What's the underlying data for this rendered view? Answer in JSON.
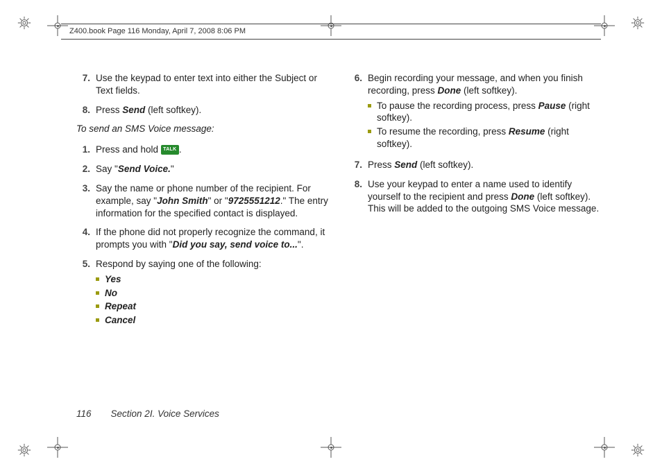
{
  "header": {
    "label": "Z400.book  Page 116  Monday, April 7, 2008  8:06 PM"
  },
  "talk_key_label": "TALK",
  "col1": {
    "cont_steps": [
      {
        "n": "7.",
        "parts": [
          {
            "t": "Use the keypad to enter text into either the Subject or Text fields."
          }
        ]
      },
      {
        "n": "8.",
        "parts": [
          {
            "t": "Press "
          },
          {
            "t": "Send",
            "cls": "bold-italic"
          },
          {
            "t": " (left softkey)."
          }
        ]
      }
    ],
    "sub_heading": "To send an SMS Voice message:",
    "steps": [
      {
        "n": "1.",
        "parts": [
          {
            "t": "Press and hold "
          },
          {
            "key": true
          },
          {
            "t": "."
          }
        ]
      },
      {
        "n": "2.",
        "parts": [
          {
            "t": "Say \""
          },
          {
            "t": "Send Voice.",
            "cls": "bold-italic"
          },
          {
            "t": "\""
          }
        ]
      },
      {
        "n": "3.",
        "parts": [
          {
            "t": "Say the name or phone number of the recipient. For example, say \""
          },
          {
            "t": "John Smith",
            "cls": "bold-italic"
          },
          {
            "t": "\" or \""
          },
          {
            "t": "9725551212",
            "cls": "bold-italic"
          },
          {
            "t": ".\" The entry information for the specified contact is displayed."
          }
        ]
      },
      {
        "n": "4.",
        "parts": [
          {
            "t": "If the phone did not properly recognize the command, it prompts you with \""
          },
          {
            "t": "Did you say, send voice to...",
            "cls": "bold-italic"
          },
          {
            "t": "\"."
          }
        ]
      },
      {
        "n": "5.",
        "parts": [
          {
            "t": "Respond by saying one of the following:"
          }
        ],
        "bullets": [
          [
            {
              "t": "Yes",
              "cls": "bold-italic"
            }
          ],
          [
            {
              "t": "No",
              "cls": "bold-italic"
            }
          ],
          [
            {
              "t": "Repeat",
              "cls": "bold-italic"
            }
          ],
          [
            {
              "t": "Cancel",
              "cls": "bold-italic"
            }
          ]
        ]
      }
    ]
  },
  "col2": {
    "steps": [
      {
        "n": "6.",
        "parts": [
          {
            "t": "Begin recording your message, and when you finish recording, press "
          },
          {
            "t": "Done",
            "cls": "bold-italic"
          },
          {
            "t": " (left softkey)."
          }
        ],
        "bullets": [
          [
            {
              "t": "To pause the recording process, press "
            },
            {
              "t": "Pause",
              "cls": "bold-italic"
            },
            {
              "t": " (right softkey)."
            }
          ],
          [
            {
              "t": "To resume the recording, press "
            },
            {
              "t": "Resume",
              "cls": "bold-italic"
            },
            {
              "t": " (right softkey)."
            }
          ]
        ]
      },
      {
        "n": "7.",
        "parts": [
          {
            "t": "Press "
          },
          {
            "t": "Send",
            "cls": "bold-italic"
          },
          {
            "t": " (left softkey)."
          }
        ]
      },
      {
        "n": "8.",
        "parts": [
          {
            "t": "Use your keypad to enter a name used to identify yourself to the recipient and press "
          },
          {
            "t": "Done",
            "cls": "bold-italic"
          },
          {
            "t": " (left softkey). This will be added to the outgoing SMS Voice message."
          }
        ]
      }
    ]
  },
  "footer": {
    "page_number": "116",
    "section": "Section 2I. Voice Services"
  }
}
